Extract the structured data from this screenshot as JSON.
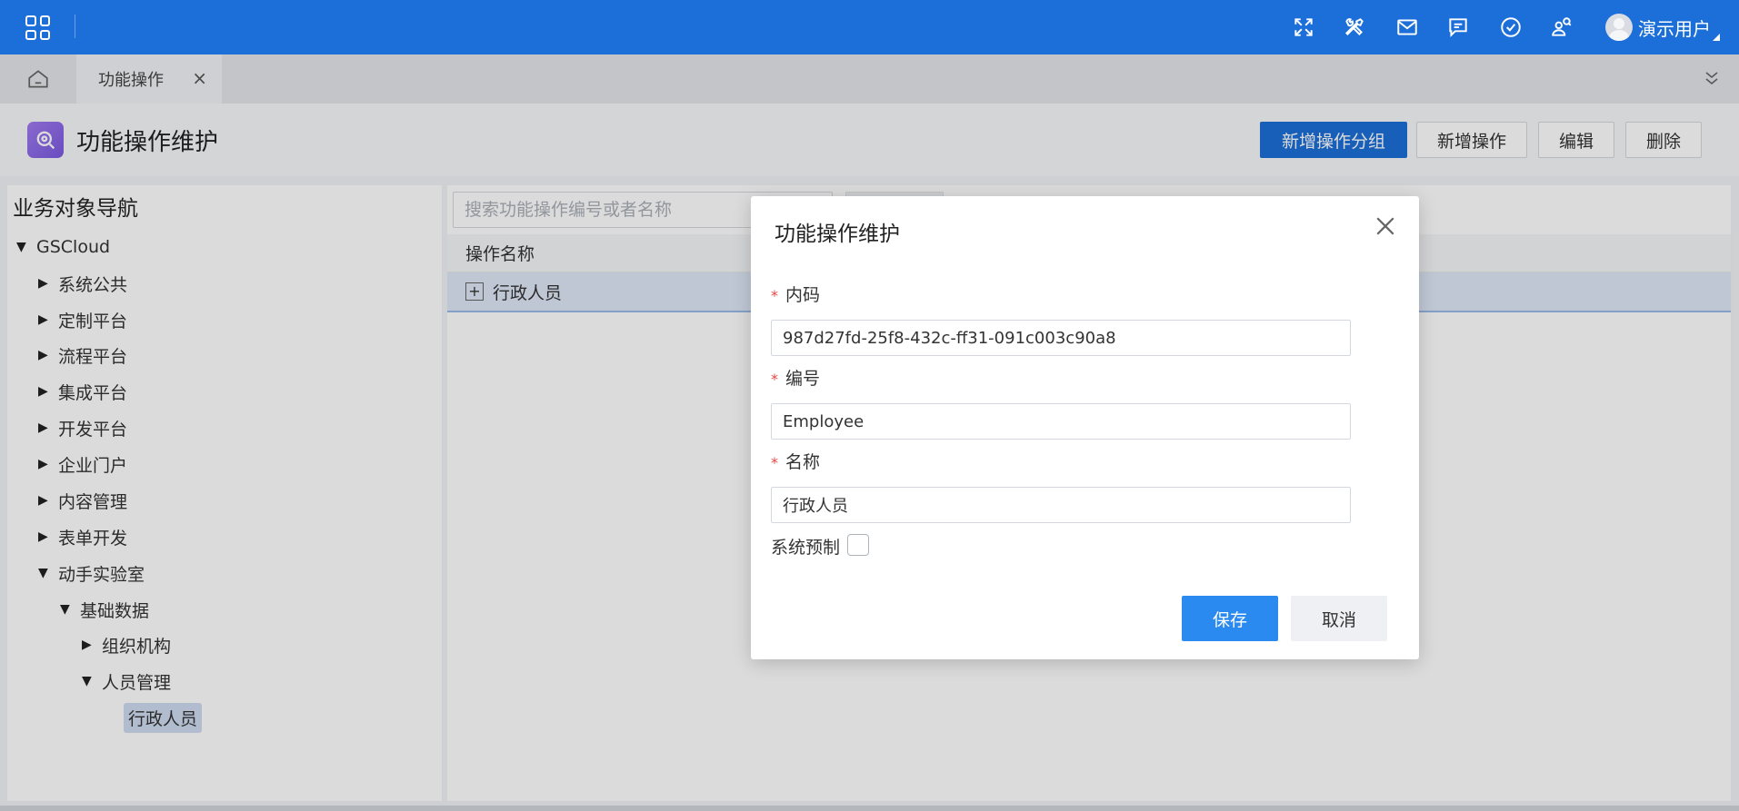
{
  "topbar": {
    "icons": [
      "grid-apps-icon",
      "fullscreen-icon",
      "tools-icon",
      "mail-icon",
      "message-icon",
      "check-circle-icon",
      "user-search-icon"
    ],
    "user_name": "演示用户"
  },
  "tabs": {
    "home_icon": "home-icon",
    "active_label": "功能操作",
    "close_glyph": "×"
  },
  "page": {
    "title": "功能操作维护",
    "buttons": {
      "add_group": "新增操作分组",
      "add_op": "新增操作",
      "edit": "编辑",
      "delete": "删除"
    }
  },
  "nav": {
    "title": "业务对象导航",
    "tree": [
      {
        "label": "GSCloud",
        "caret": "▼"
      },
      {
        "label": "系统公共",
        "caret": "▶"
      },
      {
        "label": "定制平台",
        "caret": "▶"
      },
      {
        "label": "流程平台",
        "caret": "▶"
      },
      {
        "label": "集成平台",
        "caret": "▶"
      },
      {
        "label": "开发平台",
        "caret": "▶"
      },
      {
        "label": "企业门户",
        "caret": "▶"
      },
      {
        "label": "内容管理",
        "caret": "▶"
      },
      {
        "label": "表单开发",
        "caret": "▶"
      },
      {
        "label": "动手实验室",
        "caret": "▼"
      },
      {
        "label": "基础数据",
        "caret": "▼"
      },
      {
        "label": "组织机构",
        "caret": "▶"
      },
      {
        "label": "人员管理",
        "caret": "▼"
      },
      {
        "label": "行政人员",
        "caret": ""
      }
    ]
  },
  "grid": {
    "search_placeholder": "搜索功能操作编号或者名称",
    "column_header": "操作名称",
    "rows": [
      {
        "name": "行政人员",
        "expander": "+"
      }
    ]
  },
  "modal": {
    "title": "功能操作维护",
    "fields": [
      {
        "label": "内码",
        "required": "*",
        "value": "987d27fd-25f8-432c-ff31-091c003c90a8"
      },
      {
        "label": "编号",
        "required": "*",
        "value": "Employee"
      },
      {
        "label": "名称",
        "required": "*",
        "value": "行政人员"
      }
    ],
    "checkbox_label": "系统预制",
    "checkbox_checked": false,
    "save_label": "保存",
    "cancel_label": "取消"
  }
}
